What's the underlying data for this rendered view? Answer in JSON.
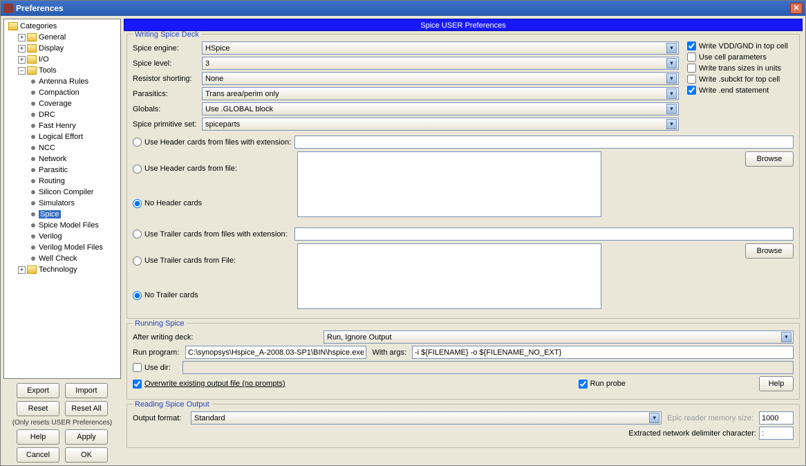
{
  "window": {
    "title": "Preferences",
    "header": "Spice USER Preferences"
  },
  "tree": {
    "root": "Categories",
    "items": [
      "General",
      "Display",
      "I/O",
      "Tools",
      "Technology"
    ],
    "tools": [
      "Antenna Rules",
      "Compaction",
      "Coverage",
      "DRC",
      "Fast Henry",
      "Logical Effort",
      "NCC",
      "Network",
      "Parasitic",
      "Routing",
      "Silicon Compiler",
      "Simulators",
      "Spice",
      "Spice Model Files",
      "Verilog",
      "Verilog Model Files",
      "Well Check"
    ]
  },
  "leftButtons": {
    "export": "Export",
    "import": "Import",
    "reset": "Reset",
    "resetAll": "Reset All",
    "note": "(Only resets USER Preferences)",
    "help": "Help",
    "apply": "Apply",
    "cancel": "Cancel",
    "ok": "OK"
  },
  "writing": {
    "legend": "Writing Spice Deck",
    "engineLabel": "Spice engine:",
    "engine": "HSpice",
    "levelLabel": "Spice level:",
    "level": "3",
    "resistorLabel": "Resistor shorting:",
    "resistor": "None",
    "parasiticsLabel": "Parasitics:",
    "parasitics": "Trans area/perim only",
    "globalsLabel": "Globals:",
    "globals": "Use .GLOBAL block",
    "primLabel": "Spice primitive set:",
    "prim": "spiceparts",
    "cb": {
      "vdd": "Write VDD/GND in top cell",
      "cell": "Use cell parameters",
      "trans": "Write trans sizes in units",
      "subckt": "Write .subckt for top cell",
      "end": "Write .end statement"
    },
    "hdr": {
      "ext": "Use Header cards from files with extension:",
      "file": "Use Header cards from file:",
      "none": "No Header cards"
    },
    "trl": {
      "ext": "Use Trailer cards from files with extension:",
      "file": "Use Trailer cards from File:",
      "none": "No Trailer cards"
    },
    "browse": "Browse"
  },
  "running": {
    "legend": "Running Spice",
    "afterLabel": "After writing deck:",
    "after": "Run, Ignore Output",
    "runProgLabel": "Run program:",
    "runProg": "C:\\synopsys\\Hspice_A-2008.03-SP1\\BIN\\hspice.exe",
    "withArgsLabel": "With args:",
    "withArgs": "-i ${FILENAME} -o ${FILENAME_NO_EXT}",
    "useDir": "Use dir:",
    "overwrite": "Overwrite existing output file (no prompts)",
    "runProbe": "Run probe",
    "help": "Help"
  },
  "reading": {
    "legend": "Reading Spice Output",
    "formatLabel": "Output format:",
    "format": "Standard",
    "memLabel": "Epic reader memory size:",
    "mem": "1000",
    "delimLabel": "Extracted network delimiter character:",
    "delim": ":"
  }
}
